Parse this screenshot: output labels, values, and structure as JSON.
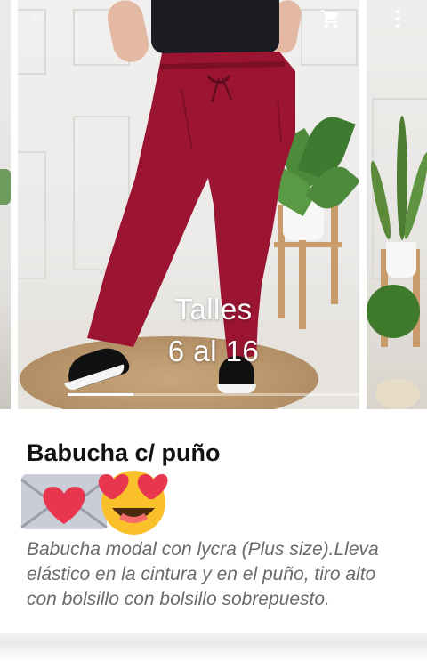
{
  "carousel": {
    "overlay_line1": "Talles",
    "overlay_line2": "6 al 16",
    "active_slide": 1,
    "slide_count": 2
  },
  "toolbar": {
    "back_icon": "back-arrow-icon",
    "cart_icon": "cart-icon",
    "more_icon": "more-vert-icon"
  },
  "product": {
    "title": "Babucha c/ puño",
    "emojis": [
      "love-letter",
      "smiling-face-with-heart-eyes"
    ],
    "description": "Babucha modal con lycra (Plus size).Lleva elástico en la cintura y en el puño,  tiro alto con bolsillo con bolsillo sobrepuesto."
  },
  "colors": {
    "pants": "#9b1533",
    "text_title": "#111111",
    "text_desc": "#6a6a6a"
  }
}
